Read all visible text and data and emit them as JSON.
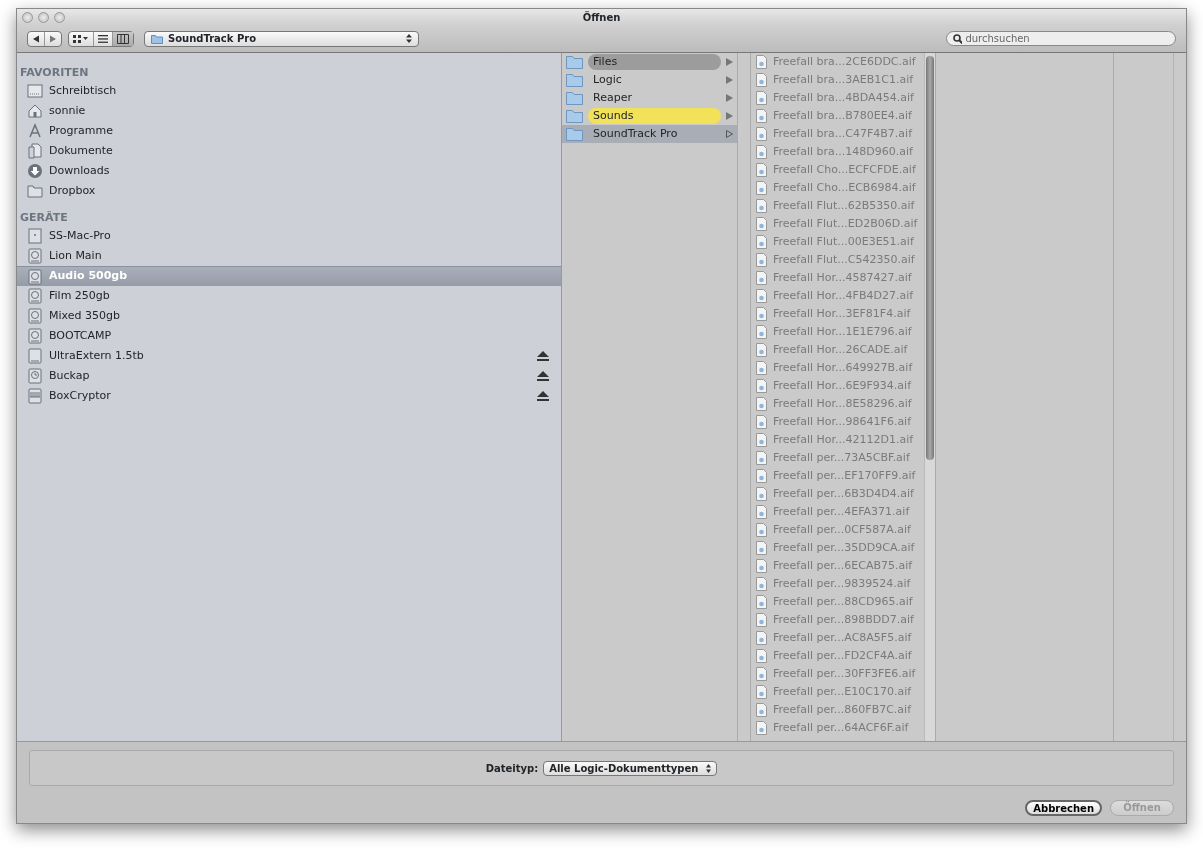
{
  "window": {
    "title": "Öffnen"
  },
  "toolbar": {
    "path_popup": "SoundTrack Pro",
    "search": {
      "placeholder": "durchsuchen"
    },
    "views": [
      {
        "kind": "icons",
        "selected": false
      },
      {
        "kind": "list",
        "selected": false
      },
      {
        "kind": "columns",
        "selected": true
      }
    ]
  },
  "sidebar": {
    "sections": [
      {
        "heading": "FAVORITEN",
        "items": [
          {
            "kind": "desktop",
            "label": "Schreibtisch",
            "selected": false,
            "ejectable": false
          },
          {
            "kind": "home",
            "label": "sonnie",
            "selected": false,
            "ejectable": false
          },
          {
            "kind": "apps",
            "label": "Programme",
            "selected": false,
            "ejectable": false
          },
          {
            "kind": "documents",
            "label": "Dokumente",
            "selected": false,
            "ejectable": false
          },
          {
            "kind": "downloads",
            "label": "Downloads",
            "selected": false,
            "ejectable": false
          },
          {
            "kind": "folder",
            "label": "Dropbox",
            "selected": false,
            "ejectable": false
          }
        ]
      },
      {
        "heading": "GERÄTE",
        "items": [
          {
            "kind": "computer",
            "label": "SS-Mac-Pro",
            "selected": false,
            "ejectable": false
          },
          {
            "kind": "disk",
            "label": "Lion Main",
            "selected": false,
            "ejectable": false
          },
          {
            "kind": "disk",
            "label": "Audio 500gb",
            "selected": true,
            "ejectable": false
          },
          {
            "kind": "disk",
            "label": "Film 250gb",
            "selected": false,
            "ejectable": false
          },
          {
            "kind": "disk",
            "label": "Mixed 350gb",
            "selected": false,
            "ejectable": false
          },
          {
            "kind": "disk",
            "label": "BOOTCAMP",
            "selected": false,
            "ejectable": false
          },
          {
            "kind": "external",
            "label": "UltraExtern 1.5tb",
            "selected": false,
            "ejectable": true
          },
          {
            "kind": "timemachine",
            "label": "Buckap",
            "selected": false,
            "ejectable": true
          },
          {
            "kind": "encrypted",
            "label": "BoxCryptor",
            "selected": false,
            "ejectable": true
          }
        ]
      }
    ]
  },
  "column_1": {
    "items": [
      {
        "label": "Files",
        "selected": false,
        "color": "#9c9c9c"
      },
      {
        "label": "Logic",
        "selected": false
      },
      {
        "label": "Reaper",
        "selected": false
      },
      {
        "label": "Sounds",
        "selected": false,
        "color": "#f2e25a"
      },
      {
        "label": "SoundTrack Pro",
        "selected": true
      }
    ]
  },
  "column_2": {
    "items": [
      {
        "label": "Freefall bra...2CE6DDC.aif",
        "disabled": true
      },
      {
        "label": "Freefall bra...3AEB1C1.aif",
        "disabled": true
      },
      {
        "label": "Freefall bra...4BDA454.aif",
        "disabled": true
      },
      {
        "label": "Freefall bra...B780EE4.aif",
        "disabled": true
      },
      {
        "label": "Freefall bra...C47F4B7.aif",
        "disabled": true
      },
      {
        "label": "Freefall bra...148D960.aif",
        "disabled": true
      },
      {
        "label": "Freefall Cho...ECFCFDE.aif",
        "disabled": true
      },
      {
        "label": "Freefall Cho...ECB6984.aif",
        "disabled": true
      },
      {
        "label": "Freefall Flut...62B5350.aif",
        "disabled": true
      },
      {
        "label": "Freefall Flut...ED2B06D.aif",
        "disabled": true
      },
      {
        "label": "Freefall Flut...00E3E51.aif",
        "disabled": true
      },
      {
        "label": "Freefall Flut...C542350.aif",
        "disabled": true
      },
      {
        "label": "Freefall Hor...4587427.aif",
        "disabled": true
      },
      {
        "label": "Freefall Hor...4FB4D27.aif",
        "disabled": true
      },
      {
        "label": "Freefall Hor...3EF81F4.aif",
        "disabled": true
      },
      {
        "label": "Freefall Hor...1E1E796.aif",
        "disabled": true
      },
      {
        "label": "Freefall Hor...26CADE.aif",
        "disabled": true
      },
      {
        "label": "Freefall Hor...649927B.aif",
        "disabled": true
      },
      {
        "label": "Freefall Hor...6E9F934.aif",
        "disabled": true
      },
      {
        "label": "Freefall Hor...8E58296.aif",
        "disabled": true
      },
      {
        "label": "Freefall Hor...98641F6.aif",
        "disabled": true
      },
      {
        "label": "Freefall Hor...42112D1.aif",
        "disabled": true
      },
      {
        "label": "Freefall per...73A5CBF.aif",
        "disabled": true
      },
      {
        "label": "Freefall per...EF170FF9.aif",
        "disabled": true
      },
      {
        "label": "Freefall per...6B3D4D4.aif",
        "disabled": true
      },
      {
        "label": "Freefall per...4EFA371.aif",
        "disabled": true
      },
      {
        "label": "Freefall per...0CF587A.aif",
        "disabled": true
      },
      {
        "label": "Freefall per...35DD9CA.aif",
        "disabled": true
      },
      {
        "label": "Freefall per...6ECAB75.aif",
        "disabled": true
      },
      {
        "label": "Freefall per...9839524.aif",
        "disabled": true
      },
      {
        "label": "Freefall per...88CD965.aif",
        "disabled": true
      },
      {
        "label": "Freefall per...898BDD7.aif",
        "disabled": true
      },
      {
        "label": "Freefall per...AC8A5F5.aif",
        "disabled": true
      },
      {
        "label": "Freefall per...FD2CF4A.aif",
        "disabled": true
      },
      {
        "label": "Freefall per...30FF3FE6.aif",
        "disabled": true
      },
      {
        "label": "Freefall per...E10C170.aif",
        "disabled": true
      },
      {
        "label": "Freefall per...860FB7C.aif",
        "disabled": true
      },
      {
        "label": "Freefall per...64ACF6F.aif",
        "disabled": true
      }
    ]
  },
  "footer": {
    "filetype_label": "Dateityp:",
    "filetype_value": "Alle Logic-Dokumenttypen",
    "buttons": [
      {
        "label": "Abbrechen",
        "disabled": false,
        "default": true
      },
      {
        "label": "Öffnen",
        "disabled": true,
        "default": false
      }
    ]
  }
}
